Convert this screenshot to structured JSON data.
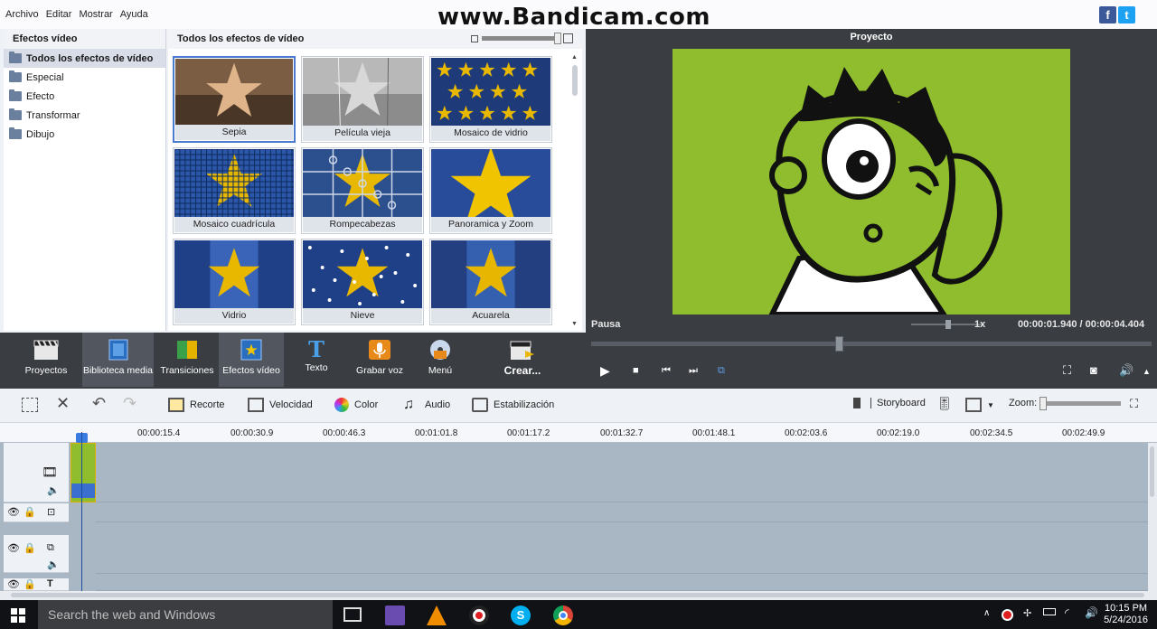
{
  "menu": [
    "Archivo",
    "Editar",
    "Mostrar",
    "Ayuda"
  ],
  "watermark": "www.Bandicam.com",
  "social": {
    "facebook": "f",
    "twitter": "t"
  },
  "categories": {
    "title": "Efectos vídeo",
    "items": [
      "Todos los efectos de vídeo",
      "Especial",
      "Efecto",
      "Transformar",
      "Dibujo"
    ]
  },
  "effects": {
    "title": "Todos los efectos de vídeo",
    "tiles": [
      "Sepia",
      "Película vieja",
      "Mosaico de vidrio",
      "Mosaico cuadrícula",
      "Rompecabezas",
      "Panoramica y Zoom",
      "Vidrio",
      "Nieve",
      "Acuarela"
    ]
  },
  "preview": {
    "title": "Proyecto",
    "state": "Pausa",
    "speed": "1x",
    "current_time": "00:00:01.940",
    "separator": "/",
    "total_time": "00:00:04.404"
  },
  "toolbar": {
    "proyectos": "Proyectos",
    "biblioteca": "Biblioteca media",
    "transiciones": "Transiciones",
    "efectos": "Efectos vídeo",
    "texto": "Texto",
    "grabar": "Grabar voz",
    "menu": "Menú",
    "crear": "Crear..."
  },
  "editbar": {
    "recorte": "Recorte",
    "velocidad": "Velocidad",
    "color": "Color",
    "audio": "Audio",
    "estabilizacion": "Estabilización",
    "storyboard": "Storyboard",
    "zoom": "Zoom:"
  },
  "ruler": [
    "00:00:15.4",
    "00:00:30.9",
    "00:00:46.3",
    "00:01:01.8",
    "00:01:17.2",
    "00:01:32.7",
    "00:01:48.1",
    "00:02:03.6",
    "00:02:19.0",
    "00:02:34.5",
    "00:02:49.9"
  ],
  "taskbar": {
    "search_placeholder": "Search the web and Windows",
    "time": "10:15 PM",
    "date": "5/24/2016"
  },
  "colors": {
    "accent": "#4a7bd0",
    "toolbar": "#3a3d42",
    "timeline": "#a9b6c4"
  }
}
